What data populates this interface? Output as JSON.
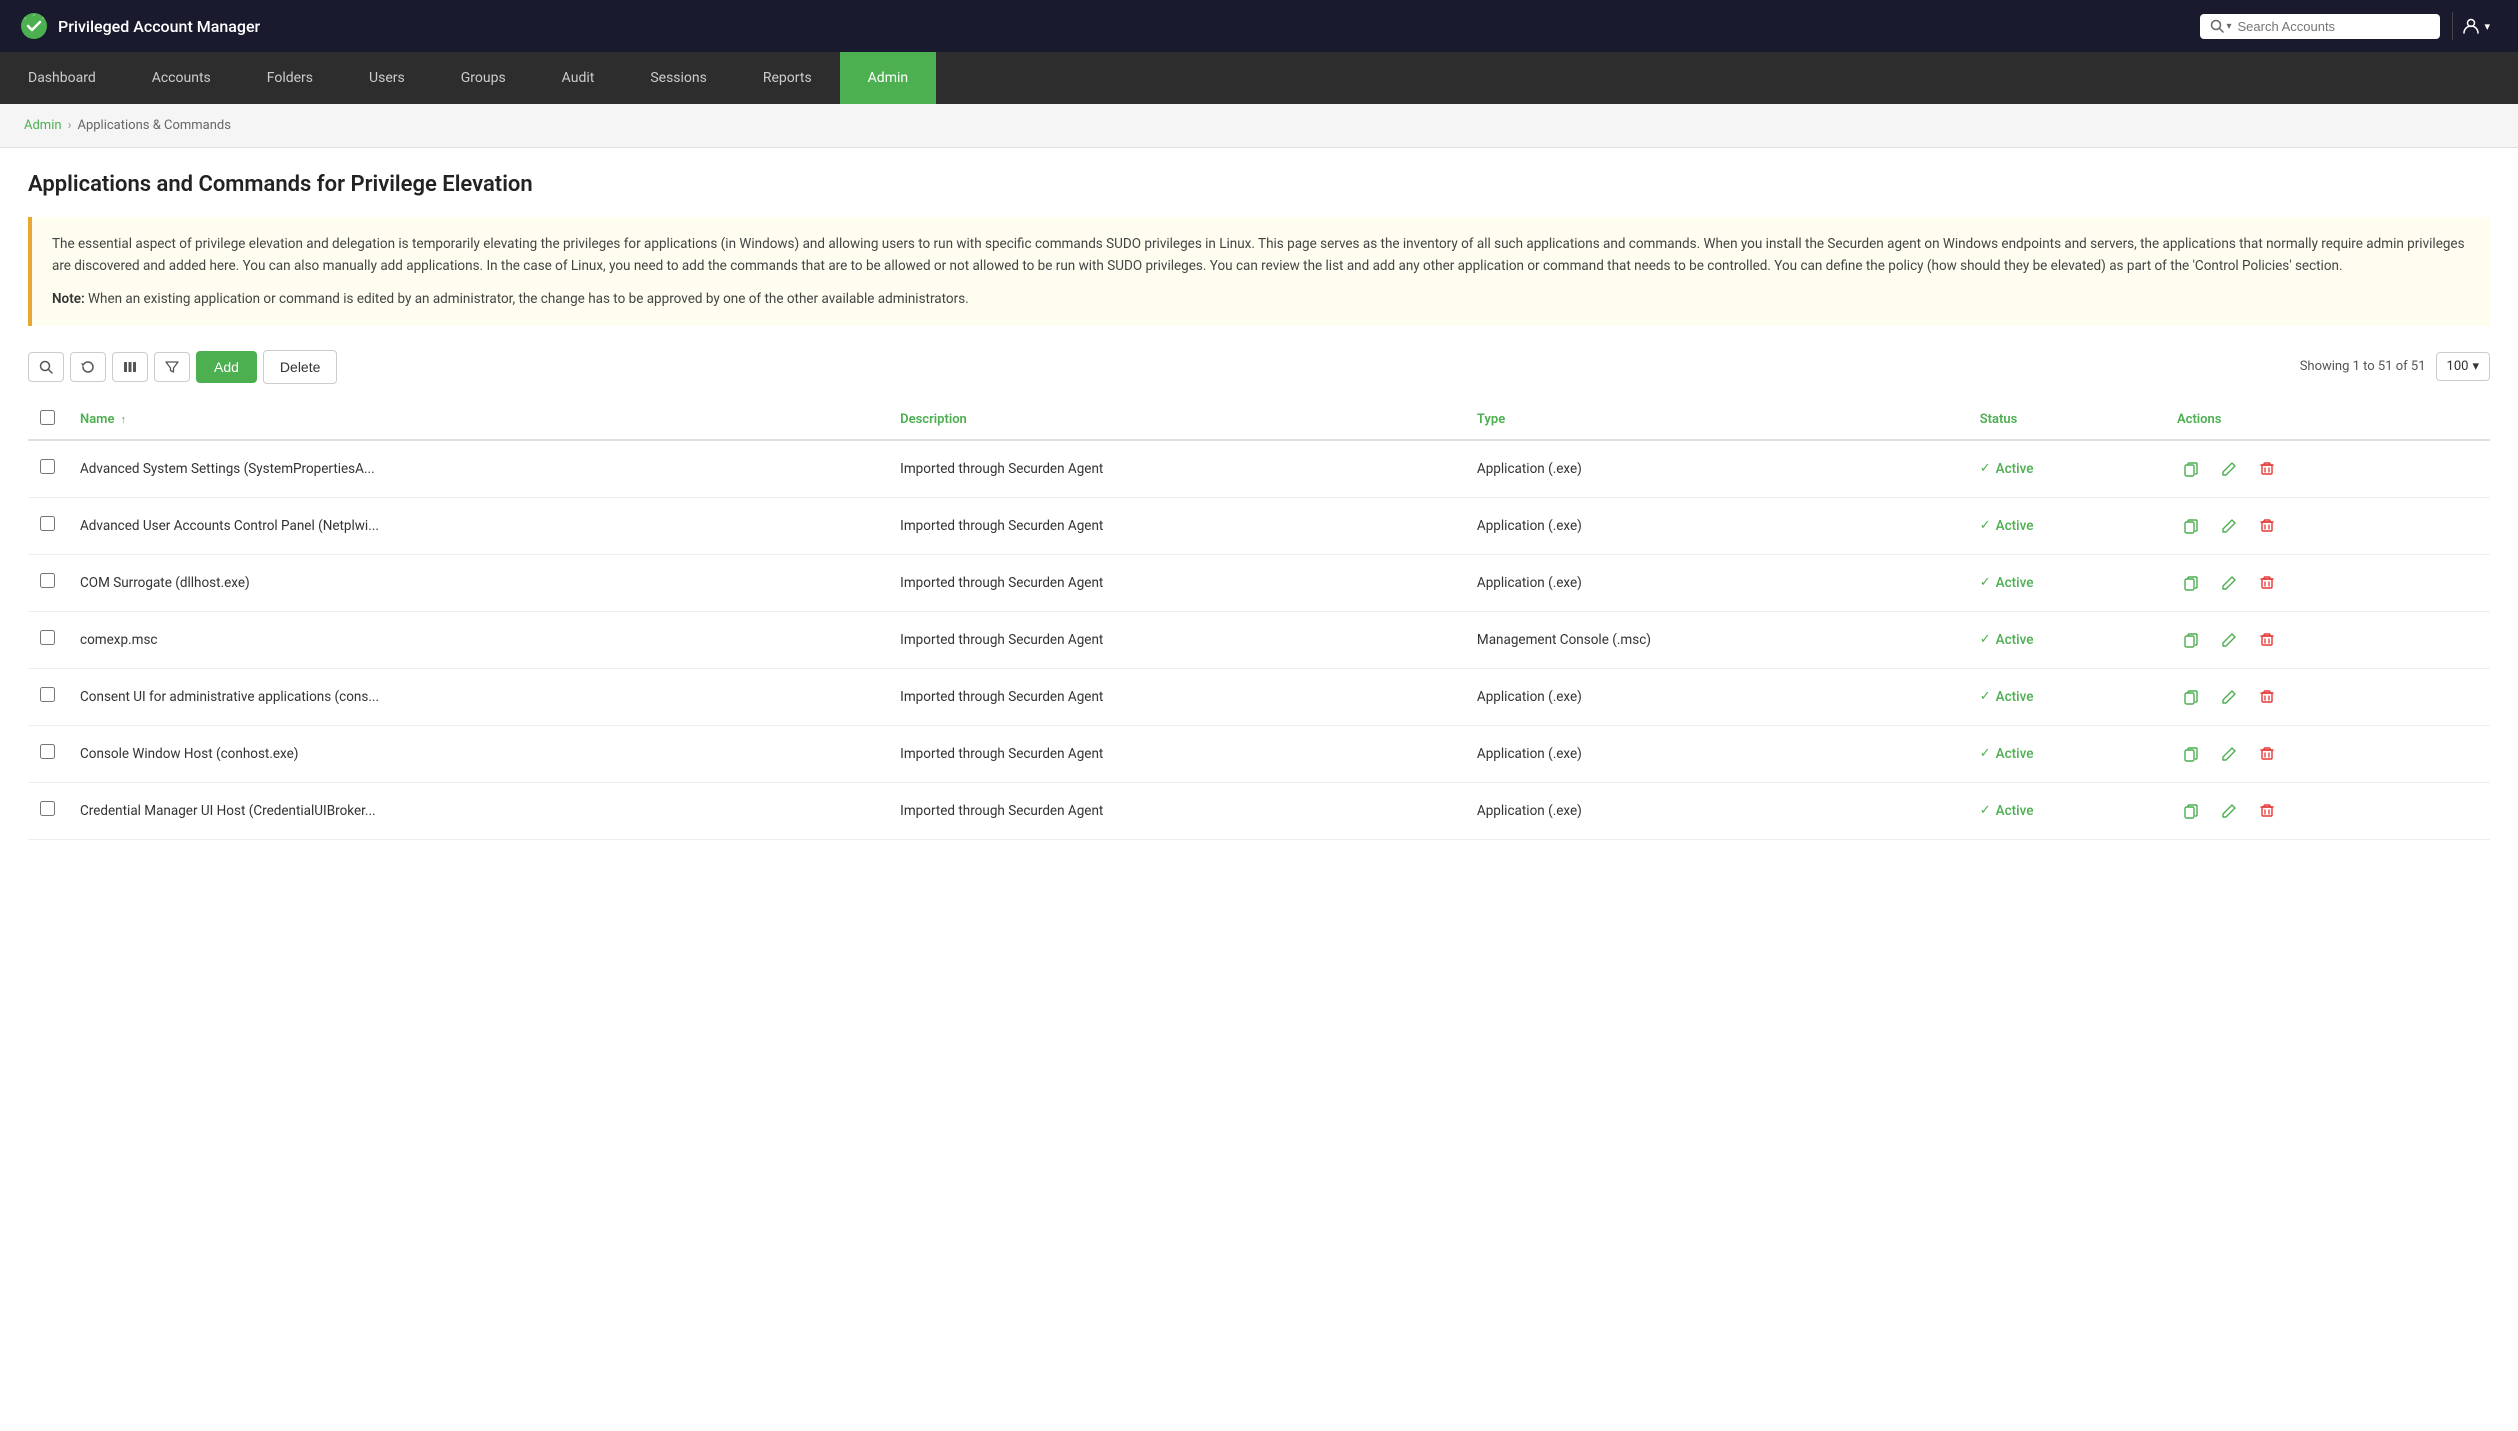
{
  "app": {
    "title": "Privileged Account Manager",
    "logo_alt": "Securden Logo"
  },
  "header": {
    "search_placeholder": "Search Accounts",
    "search_dropdown_label": "▾"
  },
  "nav": {
    "items": [
      {
        "label": "Dashboard",
        "active": false,
        "id": "dashboard"
      },
      {
        "label": "Accounts",
        "active": false,
        "id": "accounts"
      },
      {
        "label": "Folders",
        "active": false,
        "id": "folders"
      },
      {
        "label": "Users",
        "active": false,
        "id": "users"
      },
      {
        "label": "Groups",
        "active": false,
        "id": "groups"
      },
      {
        "label": "Audit",
        "active": false,
        "id": "audit"
      },
      {
        "label": "Sessions",
        "active": false,
        "id": "sessions"
      },
      {
        "label": "Reports",
        "active": false,
        "id": "reports"
      },
      {
        "label": "Admin",
        "active": true,
        "id": "admin"
      }
    ]
  },
  "breadcrumb": {
    "parent": "Admin",
    "current": "Applications & Commands"
  },
  "page": {
    "title": "Applications and Commands for Privilege Elevation",
    "info_text": "The essential aspect of privilege elevation and delegation is temporarily elevating the privileges for applications (in Windows) and allowing users to run with specific commands SUDO privileges in Linux. This page serves as the inventory of all such applications and commands. When you install the Securden agent on Windows endpoints and servers, the applications that normally require admin privileges are discovered and added here. You can also manually add applications. In the case of Linux, you need to add the commands that are to be allowed or not allowed to be run with SUDO privileges. You can review the list and add any other application or command that needs to be controlled. You can define the policy (how should they be elevated) as part of the 'Control Policies' section.",
    "note_label": "Note:",
    "note_text": " When an existing application or command is edited by an administrator, the change has to be approved by one of the other available administrators."
  },
  "toolbar": {
    "add_label": "Add",
    "delete_label": "Delete",
    "showing_text": "Showing 1 to 51 of 51",
    "per_page": "100"
  },
  "table": {
    "columns": [
      {
        "label": "Name",
        "sortable": true,
        "id": "name"
      },
      {
        "label": "Description",
        "sortable": false,
        "id": "description"
      },
      {
        "label": "Type",
        "sortable": false,
        "id": "type"
      },
      {
        "label": "Status",
        "sortable": false,
        "id": "status"
      },
      {
        "label": "Actions",
        "sortable": false,
        "id": "actions"
      }
    ],
    "rows": [
      {
        "name": "Advanced System Settings (SystemPropertiesA...",
        "description": "Imported through Securden Agent",
        "type": "Application (.exe)",
        "status": "Active"
      },
      {
        "name": "Advanced User Accounts Control Panel (Netplwi...",
        "description": "Imported through Securden Agent",
        "type": "Application (.exe)",
        "status": "Active"
      },
      {
        "name": "COM Surrogate (dllhost.exe)",
        "description": "Imported through Securden Agent",
        "type": "Application (.exe)",
        "status": "Active"
      },
      {
        "name": "comexp.msc",
        "description": "Imported through Securden Agent",
        "type": "Management Console (.msc)",
        "status": "Active"
      },
      {
        "name": "Consent UI for administrative applications (cons...",
        "description": "Imported through Securden Agent",
        "type": "Application (.exe)",
        "status": "Active"
      },
      {
        "name": "Console Window Host (conhost.exe)",
        "description": "Imported through Securden Agent",
        "type": "Application (.exe)",
        "status": "Active"
      },
      {
        "name": "Credential Manager UI Host (CredentialUIBroker...",
        "description": "Imported through Securden Agent",
        "type": "Application (.exe)",
        "status": "Active"
      }
    ]
  }
}
